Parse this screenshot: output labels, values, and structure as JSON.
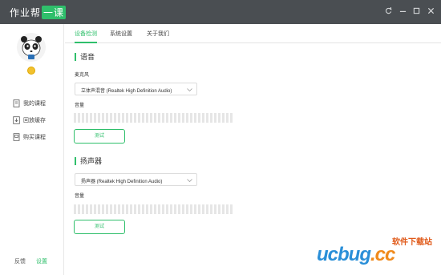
{
  "app": {
    "title_main": "作业帮",
    "title_badge": "一课"
  },
  "window_controls": [
    "refresh-icon",
    "minimize-icon",
    "maximize-icon",
    "close-icon"
  ],
  "sidebar": {
    "items": [
      {
        "label": "我的课程",
        "icon": "book-icon"
      },
      {
        "label": "回放缓存",
        "icon": "download-icon"
      },
      {
        "label": "购买课程",
        "icon": "cart-icon"
      }
    ],
    "footer": {
      "feedback": "反馈",
      "settings": "设置"
    }
  },
  "tabs": [
    {
      "label": "设备检测",
      "active": true
    },
    {
      "label": "系统设置",
      "active": false
    },
    {
      "label": "关于我们",
      "active": false
    }
  ],
  "voice": {
    "title": "语音",
    "mic_label": "麦克风",
    "mic_device": "立体声混音 (Realtek High Definition Audio)",
    "volume_label": "音量",
    "test_button": "测试"
  },
  "speaker": {
    "title": "扬声器",
    "device": "扬声器 (Realtek High Definition Audio)",
    "volume_label": "音量",
    "test_button": "测试"
  },
  "watermark": {
    "top": "软件下载站",
    "logo_a": "ucbug",
    "logo_b": ".cc"
  },
  "colors": {
    "accent": "#2fbf6b",
    "titlebar": "#4a4e52",
    "meter_idle": "#e6e6e6"
  }
}
